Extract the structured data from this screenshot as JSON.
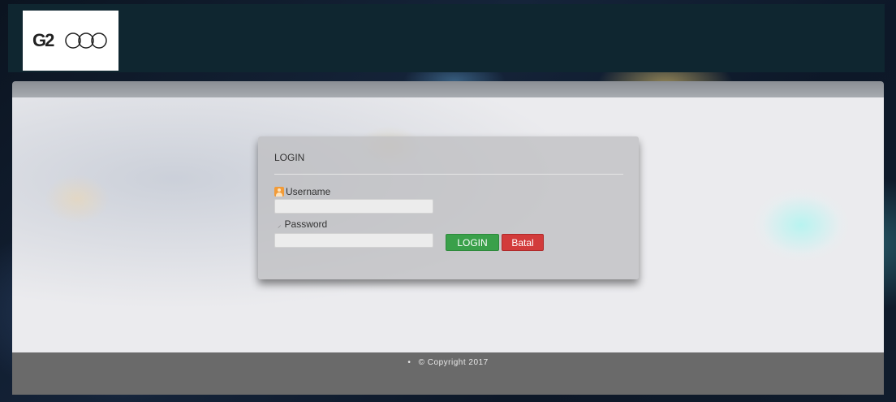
{
  "header": {
    "logo_text": "G2000"
  },
  "login_panel": {
    "title": "LOGIN",
    "username_label": "Username",
    "username_value": "",
    "password_label": "Password",
    "password_value": "",
    "login_button": "LOGIN",
    "cancel_button": "Batal"
  },
  "footer": {
    "bullet": "•",
    "copyright": "© Copyright 2017"
  },
  "colors": {
    "header_bg": "#0f2630",
    "login_button": "#3aa04a",
    "cancel_button": "#d23b3b",
    "footer_bg": "#6a6a6a"
  },
  "icons": {
    "username": "user-icon",
    "password": "key-icon"
  }
}
